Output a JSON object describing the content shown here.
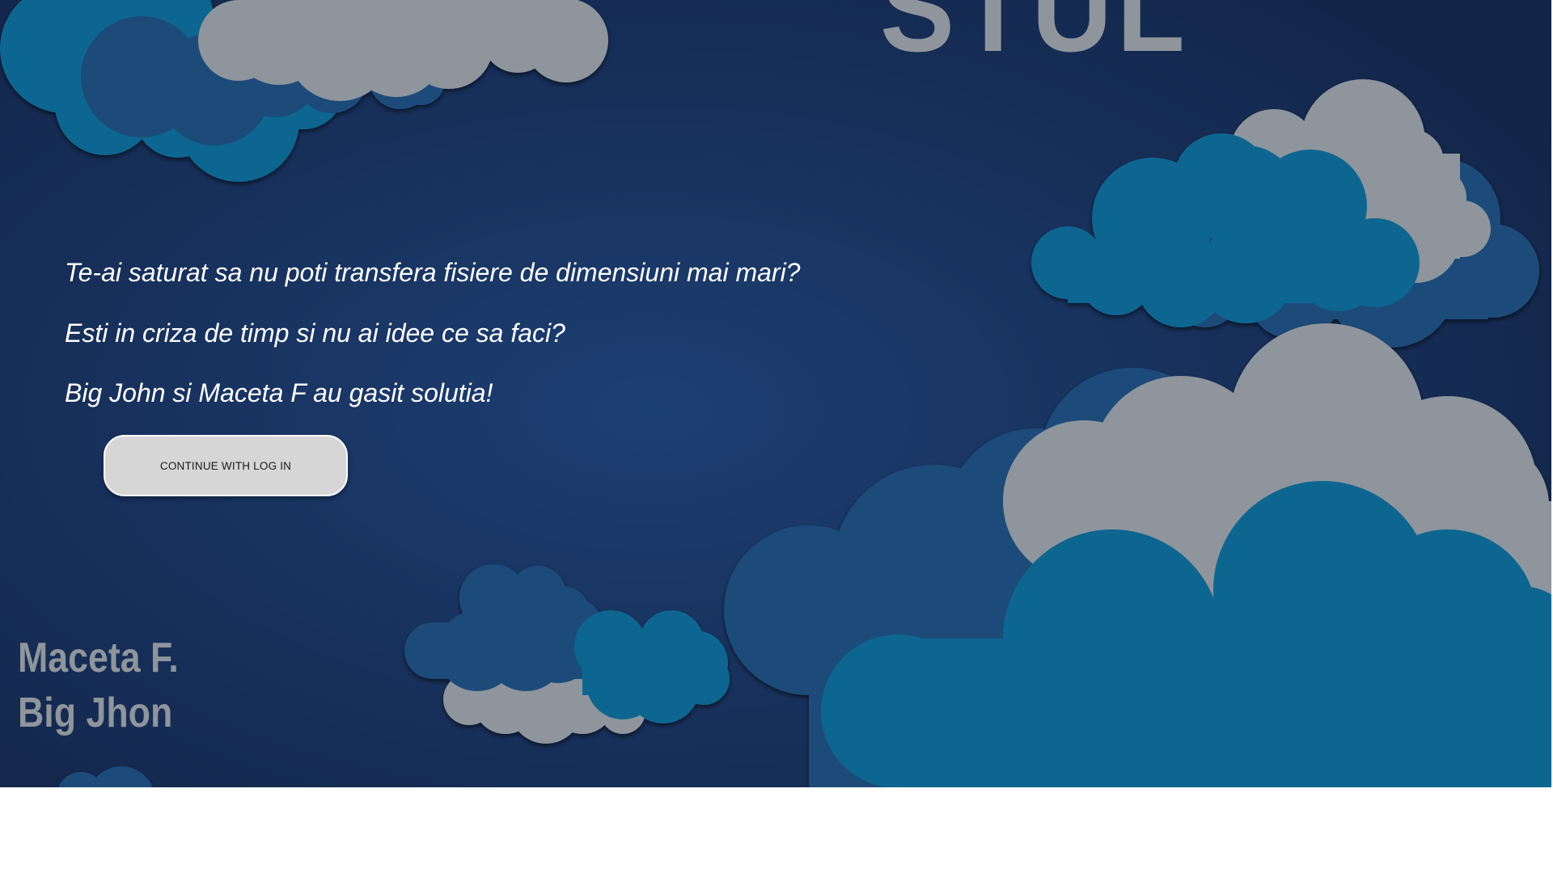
{
  "hero": {
    "brand_title": "STUL",
    "taglines": [
      "Te-ai saturat sa nu poti transfera fisiere de dimensiuni mai mari?",
      "Esti in criza de timp si nu ai idee ce sa faci?",
      "Big John si Maceta F au gasit solutia!"
    ],
    "cta_label": "CONTINUE WITH LOG IN",
    "authors": [
      "Maceta F.",
      "Big Jhon"
    ]
  },
  "colors": {
    "background_dark": "#122447",
    "background_light": "#1c3f72",
    "cloud_teal": "#0b6690",
    "cloud_blue": "#1d4b7a",
    "cloud_gray": "#8e959c",
    "button_fill": "#d6d6d6"
  }
}
